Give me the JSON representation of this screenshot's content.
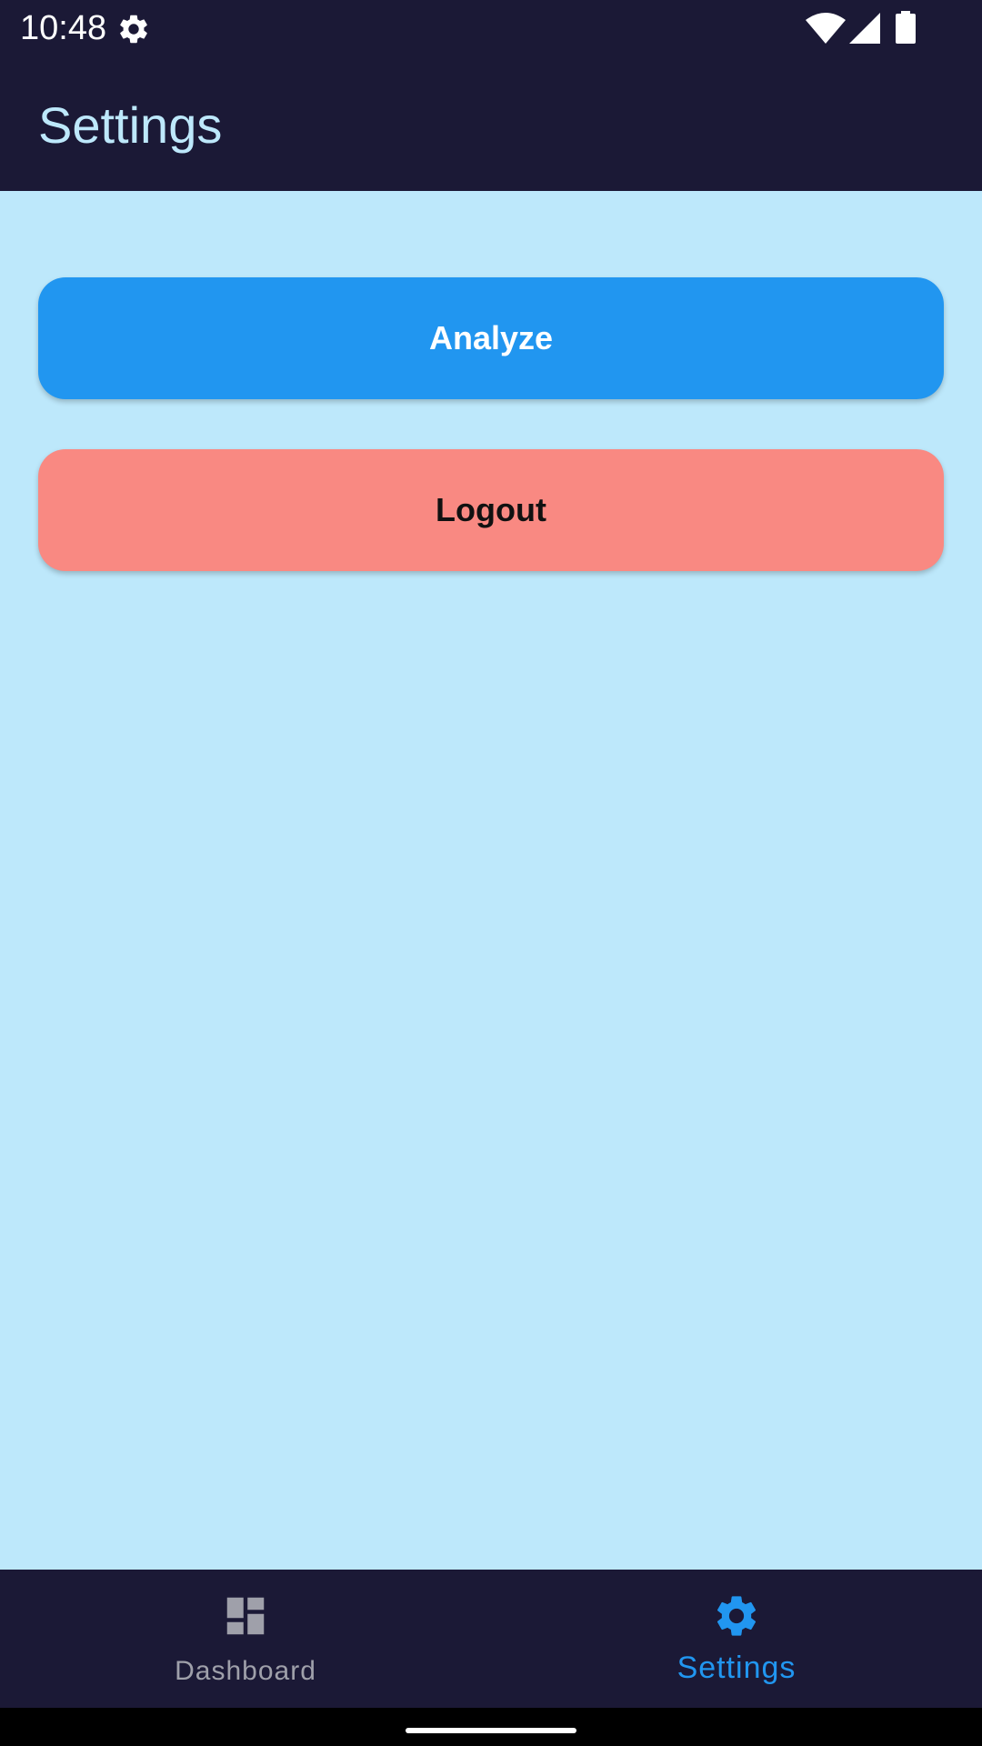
{
  "status_bar": {
    "time": "10:48",
    "icons": [
      "gear-icon",
      "wifi-icon",
      "signal-icon",
      "battery-icon"
    ]
  },
  "app_bar": {
    "title": "Settings"
  },
  "actions": {
    "analyze_label": "Analyze",
    "logout_label": "Logout"
  },
  "bottom_nav": {
    "items": [
      {
        "label": "Dashboard",
        "icon": "dashboard-icon",
        "active": false
      },
      {
        "label": "Settings",
        "icon": "gear-icon",
        "active": true
      }
    ]
  },
  "colors": {
    "app_bar_bg": "#1b1936",
    "content_bg": "#bde8fb",
    "analyze_bg": "#2196f0",
    "logout_bg": "#f98982",
    "nav_active": "#2196f0",
    "nav_inactive": "#9fa0aa"
  }
}
